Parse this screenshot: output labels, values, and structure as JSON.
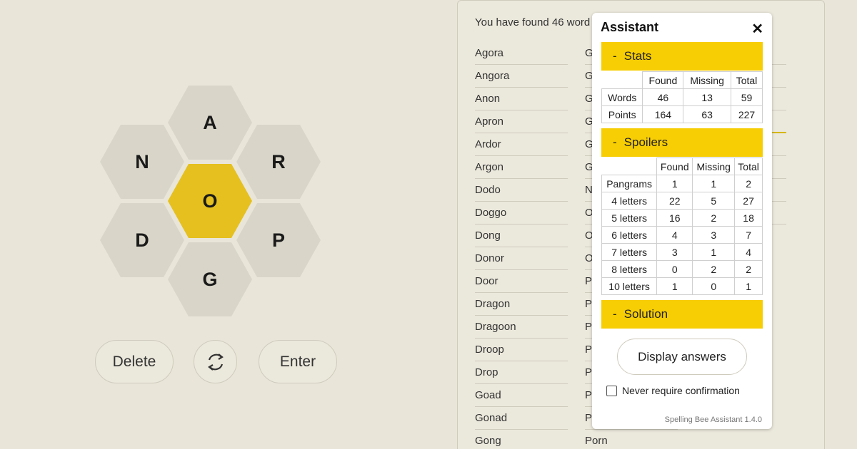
{
  "hive": {
    "letters": {
      "top": "A",
      "upper_left": "N",
      "upper_right": "R",
      "center": "O",
      "lower_left": "D",
      "lower_right": "P",
      "bottom": "G"
    },
    "center_color": "#e5c01f",
    "outer_color": "#d9d6c9"
  },
  "controls": {
    "delete_label": "Delete",
    "enter_label": "Enter",
    "shuffle_icon": "shuffle-icon"
  },
  "wordlist": {
    "found_text": "You have found 46 word",
    "col1": [
      "Agora",
      "Angora",
      "Anon",
      "Apron",
      "Ardor",
      "Argon",
      "Dodo",
      "Doggo",
      "Dong",
      "Donor",
      "Door",
      "Dragon",
      "Dragoon",
      "Droop",
      "Drop",
      "Goad",
      "Gonad",
      "Gong"
    ],
    "col2": [
      "G",
      "G",
      "G",
      "G",
      "G",
      "G",
      "N",
      "O",
      "O",
      "O",
      "P",
      "P",
      "P",
      "P",
      "P",
      "P",
      "P",
      "Porn"
    ]
  },
  "assistant": {
    "title": "Assistant",
    "close_icon": "close-icon",
    "stats": {
      "label": "Stats",
      "headers": [
        "Found",
        "Missing",
        "Total"
      ],
      "rows": [
        {
          "label": "Words",
          "found": "46",
          "missing": "13",
          "total": "59"
        },
        {
          "label": "Points",
          "found": "164",
          "missing": "63",
          "total": "227"
        }
      ]
    },
    "spoilers": {
      "label": "Spoilers",
      "headers": [
        "Found",
        "Missing",
        "Total"
      ],
      "rows": [
        {
          "label": "Pangrams",
          "found": "1",
          "missing": "1",
          "total": "2"
        },
        {
          "label": "4 letters",
          "found": "22",
          "missing": "5",
          "total": "27"
        },
        {
          "label": "5 letters",
          "found": "16",
          "missing": "2",
          "total": "18"
        },
        {
          "label": "6 letters",
          "found": "4",
          "missing": "3",
          "total": "7"
        },
        {
          "label": "7 letters",
          "found": "3",
          "missing": "1",
          "total": "4"
        },
        {
          "label": "8 letters",
          "found": "0",
          "missing": "2",
          "total": "2"
        },
        {
          "label": "10 letters",
          "found": "1",
          "missing": "0",
          "total": "1"
        }
      ]
    },
    "solution": {
      "label": "Solution"
    },
    "section_toggle": "-",
    "display_answers_label": "Display answers",
    "confirm_label": "Never require confirmation",
    "version": "Spelling Bee Assistant 1.4.0",
    "accent_color": "#f7cd04"
  }
}
